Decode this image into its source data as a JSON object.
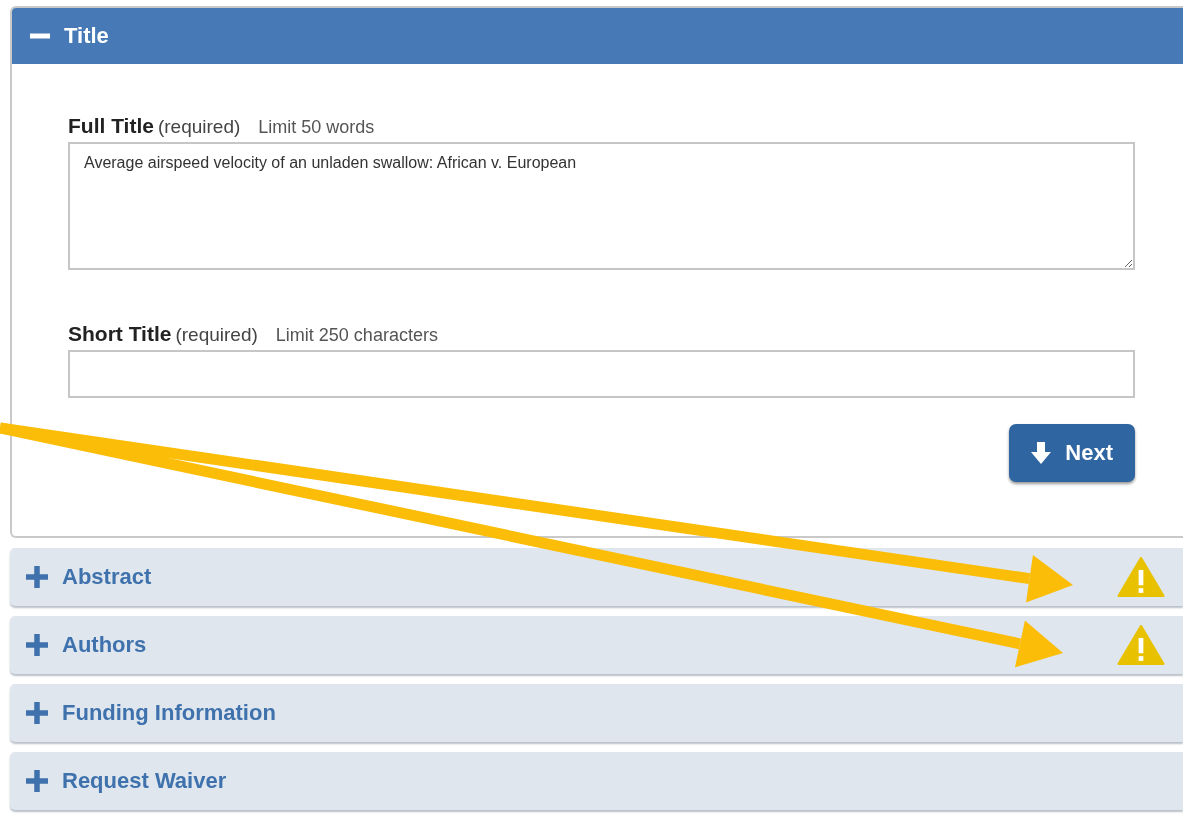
{
  "panels": [
    {
      "title": "Title",
      "expanded": true,
      "warning": false,
      "arrow_pointer": false,
      "fields": [
        {
          "kind": "textarea",
          "label": "Full Title",
          "required": "(required)",
          "hint": "Limit 50 words",
          "value": "Average airspeed velocity of an unladen swallow: African v. European"
        },
        {
          "kind": "input",
          "label": "Short Title",
          "required": "(required)",
          "hint": "Limit 250 characters"
        }
      ],
      "next_button": "Next"
    },
    {
      "title": "Abstract",
      "expanded": false,
      "warning": true,
      "arrow_pointer": true
    },
    {
      "title": "Authors",
      "expanded": false,
      "warning": true,
      "arrow_pointer": true
    },
    {
      "title": "Funding Information",
      "expanded": false,
      "warning": false,
      "arrow_pointer": false
    },
    {
      "title": "Request Waiver",
      "expanded": false,
      "warning": false,
      "arrow_pointer": false
    }
  ]
}
